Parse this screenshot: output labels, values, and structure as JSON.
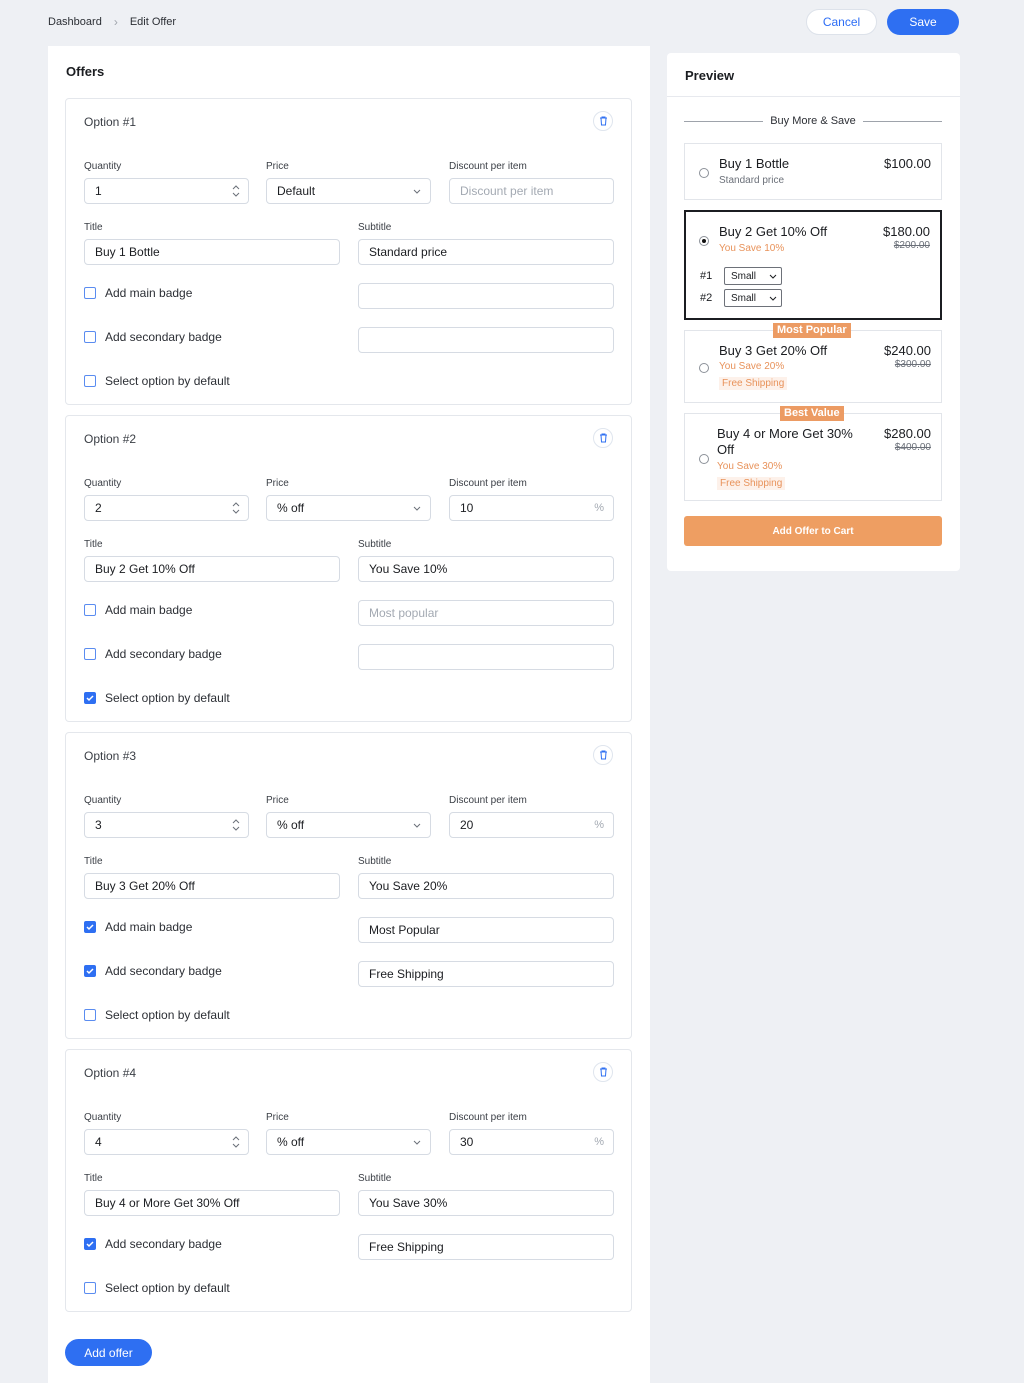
{
  "breadcrumb": {
    "root": "Dashboard",
    "current": "Edit Offer"
  },
  "actions": {
    "cancel": "Cancel",
    "save": "Save"
  },
  "offers_title": "Offers",
  "labels": {
    "quantity": "Quantity",
    "price": "Price",
    "discount": "Discount per item",
    "title": "Title",
    "subtitle": "Subtitle",
    "main_badge": "Add main badge",
    "secondary_badge": "Add secondary badge",
    "default": "Select option by default"
  },
  "options": [
    {
      "name": "Option #1",
      "quantity": "1",
      "price": "Default",
      "discount": "",
      "discount_placeholder": "Discount per item",
      "title": "Buy 1 Bottle",
      "subtitle": "Standard price",
      "main_badge_checked": false,
      "main_badge_value": "",
      "secondary_badge_checked": false,
      "secondary_badge_value": "",
      "default_checked": false
    },
    {
      "name": "Option #2",
      "quantity": "2",
      "price": "% off",
      "discount": "10",
      "discount_suffix": "%",
      "title": "Buy 2 Get 10% Off",
      "subtitle": "You Save 10%",
      "main_badge_checked": false,
      "main_badge_placeholder": "Most popular",
      "secondary_badge_checked": false,
      "secondary_badge_value": "",
      "default_checked": true
    },
    {
      "name": "Option #3",
      "quantity": "3",
      "price": "% off",
      "discount": "20",
      "discount_suffix": "%",
      "title": "Buy 3 Get 20% Off",
      "subtitle": "You Save 20%",
      "main_badge_checked": true,
      "main_badge_value": "Most Popular",
      "secondary_badge_checked": true,
      "secondary_badge_value": "Free Shipping",
      "default_checked": false
    },
    {
      "name": "Option #4",
      "quantity": "4",
      "price": "% off",
      "discount": "30",
      "discount_suffix": "%",
      "title": "Buy 4 or More Get 30% Off",
      "subtitle": "You Save 30%",
      "secondary_badge_checked": true,
      "secondary_badge_value": "Free Shipping",
      "default_checked": false
    }
  ],
  "add_offer": "Add offer",
  "preview": {
    "title": "Preview",
    "header": "Buy More & Save",
    "cards": [
      {
        "title": "Buy 1 Bottle",
        "subtitle": "Standard price",
        "price": "$100.00"
      },
      {
        "title": "Buy 2 Get 10% Off",
        "subtitle": "You Save 10%",
        "price": "$180.00",
        "original": "$200.00",
        "variants": [
          {
            "num": "#1",
            "value": "Small"
          },
          {
            "num": "#2",
            "value": "Small"
          }
        ]
      },
      {
        "badge": "Most Popular",
        "title": "Buy 3 Get 20% Off",
        "subtitle": "You Save 20%",
        "shipping": "Free Shipping",
        "price": "$240.00",
        "original": "$300.00"
      },
      {
        "badge": "Best Value",
        "title_line1": "Buy 4 or More Get 30%",
        "title_line2": "Off",
        "subtitle": "You Save 30%",
        "shipping": "Free Shipping",
        "price": "$280.00",
        "original": "$400.00"
      }
    ],
    "add_to_cart": "Add Offer to Cart"
  },
  "colors": {
    "accent": "#2e6ff2",
    "orange": "#ec9b63",
    "background": "#eef0f4"
  }
}
